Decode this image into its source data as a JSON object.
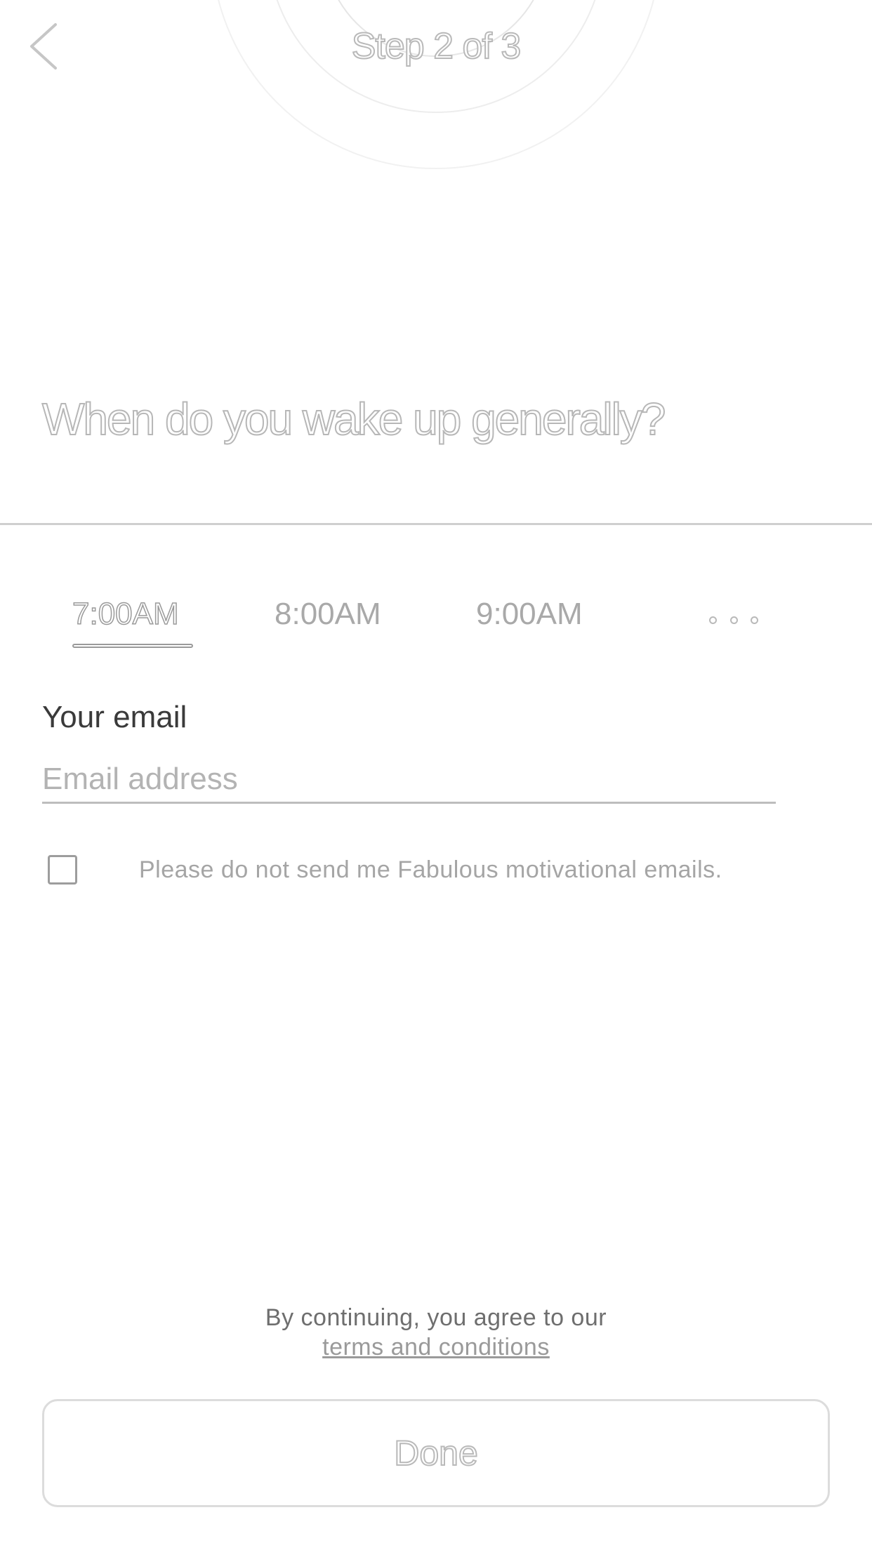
{
  "header": {
    "step_label": "Step 2 of 3",
    "back_icon": "chevron-left-icon"
  },
  "question": {
    "title": "When do you wake up generally?"
  },
  "time_picker": {
    "options": [
      "7:00AM",
      "8:00AM",
      "9:00AM"
    ],
    "selected": "7:00AM",
    "more_icon": "more-dots-icon"
  },
  "email": {
    "label": "Your email",
    "placeholder": "Email address",
    "value": ""
  },
  "optout": {
    "checked": false,
    "label": "Please do not send me Fabulous motivational emails."
  },
  "terms": {
    "intro": "By continuing, you agree to our",
    "link": "terms and conditions"
  },
  "footer": {
    "done_label": "Done"
  },
  "colors": {
    "background": "#ffffff",
    "text_primary": "#3a3a3a",
    "text_muted": "#a9a9a9",
    "outline": "#b9b9b9"
  }
}
